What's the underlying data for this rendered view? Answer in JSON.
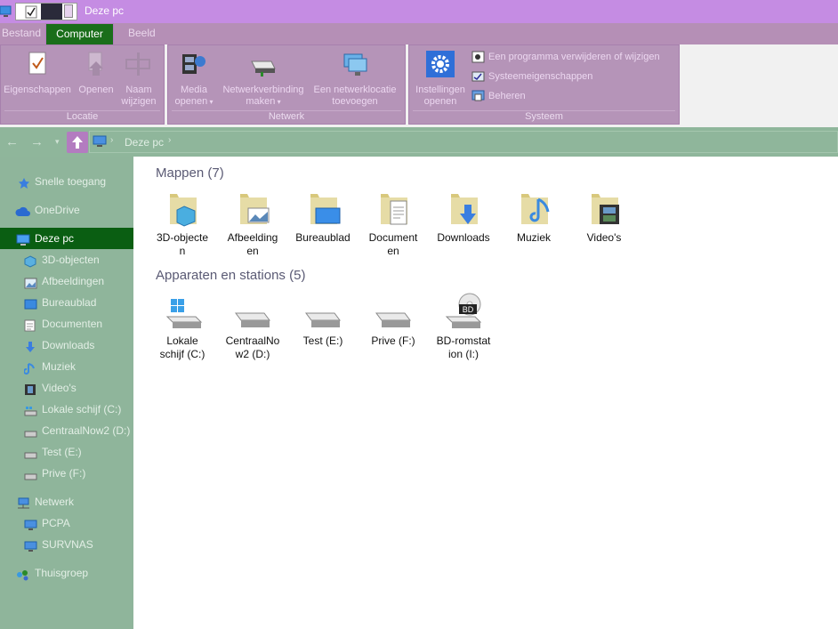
{
  "window": {
    "title": "Deze pc"
  },
  "tabs": [
    "Bestand",
    "Computer",
    "Beeld"
  ],
  "active_tab": "Computer",
  "ribbon": {
    "locatie": {
      "label": "Locatie",
      "eigenschappen": "Eigenschappen",
      "openen": "Openen",
      "naam_line1": "Naam",
      "naam_line2": "wijzigen"
    },
    "netwerk": {
      "label": "Netwerk",
      "media_line1": "Media",
      "media_line2": "openen",
      "netverb_line1": "Netwerkverbinding",
      "netverb_line2": "maken",
      "netloc_line1": "Een netwerklocatie",
      "netloc_line2": "toevoegen"
    },
    "systeem": {
      "label": "Systeem",
      "inst_line1": "Instellingen",
      "inst_line2": "openen",
      "verwijderen": "Een programma verwijderen of wijzigen",
      "systeemeigenschappen": "Systeemeigenschappen",
      "beheren": "Beheren"
    }
  },
  "address": {
    "crumb": "Deze pc"
  },
  "sidebar": {
    "snelle": "Snelle toegang",
    "onedrive": "OneDrive",
    "dezepc": "Deze pc",
    "d3": "3D-objecten",
    "afb": "Afbeeldingen",
    "bureau": "Bureaublad",
    "docs": "Documenten",
    "downloads": "Downloads",
    "muziek": "Muziek",
    "videos": "Video's",
    "lokale": "Lokale schijf (C:)",
    "centraal": "CentraalNow2 (D:)",
    "test": "Test (E:)",
    "prive": "Prive (F:)",
    "netwerk": "Netwerk",
    "pcpa": "PCPA",
    "survnas": "SURVNAS",
    "thuisgroep": "Thuisgroep"
  },
  "content": {
    "mappen_header": "Mappen (7)",
    "folders": {
      "d3": [
        "3D-objecte",
        "n"
      ],
      "afb": [
        "Afbeelding",
        "en"
      ],
      "bureau": [
        "Bureaublad",
        ""
      ],
      "docs": [
        "Document",
        "en"
      ],
      "downloads": [
        "Downloads",
        ""
      ],
      "muziek": [
        "Muziek",
        ""
      ],
      "videos": [
        "Video's",
        ""
      ]
    },
    "drives_header": "Apparaten en stations (5)",
    "drives": {
      "c": [
        "Lokale",
        "schijf (C:)"
      ],
      "d": [
        "CentraalNo",
        "w2 (D:)"
      ],
      "e": [
        "Test (E:)",
        ""
      ],
      "f": [
        "Prive (F:)",
        ""
      ],
      "bd": [
        "BD-romstat",
        "ion (I:)"
      ]
    },
    "bd_badge": "BD"
  },
  "colors": {
    "titlebar": "#c58ce3",
    "ribbon": "#b594b8",
    "active_tab": "#1a6e1a",
    "sidebar": "#8fb59b",
    "selected_nav": "#0a5e12"
  }
}
